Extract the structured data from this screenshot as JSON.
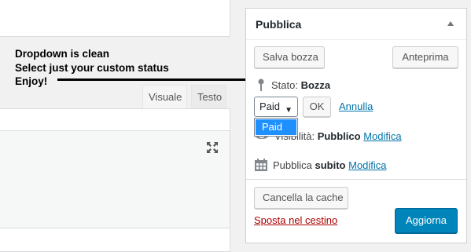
{
  "editor": {
    "tabs": [
      {
        "label": "Visuale"
      },
      {
        "label": "Testo"
      }
    ],
    "fullscreen_icon": "fullscreen-icon"
  },
  "annotation": {
    "lines": [
      "Dropdown is clean",
      "Select just your custom status",
      "Enjoy!"
    ]
  },
  "publish": {
    "title": "Pubblica",
    "save_draft_label": "Salva bozza",
    "preview_label": "Anteprima",
    "status": {
      "label": "Stato:",
      "value": "Bozza",
      "selected_option": "Paid",
      "dropdown_options": [
        "Paid"
      ],
      "ok_label": "OK",
      "cancel_label": "Annulla"
    },
    "visibility": {
      "label": "Visibilità:",
      "value": "Pubblico",
      "edit_label": "Modifica"
    },
    "schedule": {
      "label": "Pubblica",
      "value": "subito",
      "edit_label": "Modifica"
    },
    "clear_cache_label": "Cancella la cache",
    "trash_label": "Sposta nel cestino",
    "update_label": "Aggiorna"
  },
  "colors": {
    "primary_button": "#0085ba",
    "link": "#0073aa",
    "trash_link": "#aa0000",
    "dropdown_highlight": "#1e90ff"
  }
}
